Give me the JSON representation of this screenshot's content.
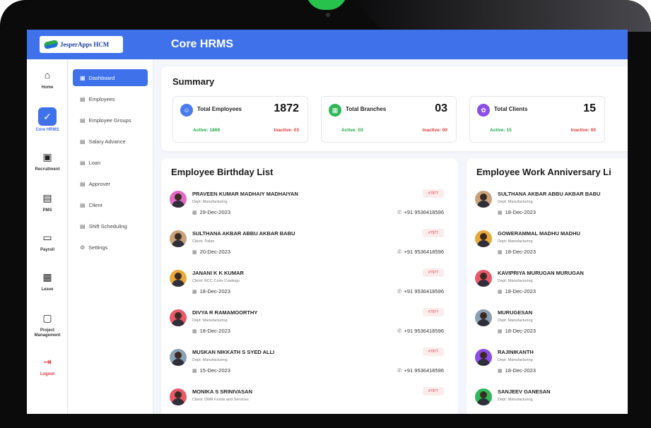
{
  "header": {
    "logo_text": "JesperApps HCM",
    "title": "Core HRMS"
  },
  "rail": [
    {
      "label": "Home",
      "icon": "home-icon",
      "glyph": "⌂"
    },
    {
      "label": "Core HRMS",
      "icon": "shield-check-icon",
      "glyph": "✓",
      "active": true
    },
    {
      "label": "Recruitment",
      "icon": "briefcase-icon",
      "glyph": "▣"
    },
    {
      "label": "PMS",
      "icon": "clipboard-icon",
      "glyph": "▤"
    },
    {
      "label": "Payroll",
      "icon": "wallet-icon",
      "glyph": "▭"
    },
    {
      "label": "Leave",
      "icon": "calendar-icon",
      "glyph": "▦"
    },
    {
      "label": "Project Management",
      "icon": "document-icon",
      "glyph": "▢"
    },
    {
      "label": "Logout",
      "icon": "logout-icon",
      "glyph": "⇥"
    }
  ],
  "submenu": [
    {
      "label": "Dashboard",
      "icon": "grid-icon",
      "active": true
    },
    {
      "label": "Employees",
      "icon": "list-icon"
    },
    {
      "label": "Employee Groups",
      "icon": "list-icon"
    },
    {
      "label": "Salary Advance",
      "icon": "list-icon"
    },
    {
      "label": "Loan",
      "icon": "list-icon"
    },
    {
      "label": "Approver",
      "icon": "list-icon"
    },
    {
      "label": "Client",
      "icon": "list-icon"
    },
    {
      "label": "Shift Scheduling",
      "icon": "list-icon"
    },
    {
      "label": "Settings",
      "icon": "gear-icon"
    }
  ],
  "summary": {
    "title": "Summary",
    "stats": [
      {
        "label": "Total Employees",
        "value": "1872",
        "active": "Active: 1869",
        "inactive": "Inactive: 03",
        "icon": "users-icon",
        "color": "#4a7bee"
      },
      {
        "label": "Total Branches",
        "value": "03",
        "active": "Active: 03",
        "inactive": "Inactive: 00",
        "icon": "building-icon",
        "color": "#2fb75a"
      },
      {
        "label": "Total Clients",
        "value": "15",
        "active": "Active: 15",
        "inactive": "Inactive: 00",
        "icon": "handshake-icon",
        "color": "#8b4ee6"
      }
    ]
  },
  "birthdays": {
    "title": "Employee Birthday List",
    "items": [
      {
        "name": "PRAVEEN KUMAR MADHAIY MADHAIYAN",
        "sub": "Dept: Manufacturing",
        "date": "29-Dec-2023",
        "badge": "#7977",
        "phone": "+91 9536418596",
        "ring": "#e26ac5"
      },
      {
        "name": "SULTHANA AKBAR ABBU AKBAR BABU",
        "sub": "Client: Tollan",
        "date": "20-Dec-2023",
        "badge": "#7977",
        "phone": "+91 9536418596",
        "ring": "#c8a27a"
      },
      {
        "name": "JANANI K K KUMAR",
        "sub": "Client: RCC Color Coatings",
        "date": "18-Dec-2023",
        "badge": "#7977",
        "phone": "+91 9536418596",
        "ring": "#e7a93a"
      },
      {
        "name": "DIVYA R RAMAMOORTHY",
        "sub": "Dept: Manufacturing",
        "date": "18-Dec-2023",
        "badge": "#7977",
        "phone": "+91 9536418596",
        "ring": "#e85a6a"
      },
      {
        "name": "MUSKAN NIKKATH S SYED ALLI",
        "sub": "Dept: Manufacturing",
        "date": "15-Dec-2023",
        "badge": "#7977",
        "phone": "+91 9536418596",
        "ring": "#8aa0b3"
      },
      {
        "name": "MONIKA S SRINIVASAN",
        "sub": "Client: DMR Foods and Services",
        "date": "",
        "badge": "#7977",
        "phone": "",
        "ring": "#e85a6a"
      }
    ]
  },
  "anniversaries": {
    "title": "Employee Work Anniversary Li",
    "items": [
      {
        "name": "SULTHANA AKBAR ABBU AKBAR BABU",
        "sub": "Dept: Manufacturing",
        "date": "18-Dec-2023",
        "ring": "#c8a27a"
      },
      {
        "name": "GOWERAMMAL MADHU MADHU",
        "sub": "Dept: Manufacturing",
        "date": "18-Dec-2023",
        "ring": "#e7a93a"
      },
      {
        "name": "KAVIPRIYA MURUGAN MURUGAN",
        "sub": "Dept: Manufacturing",
        "date": "18-Dec-2023",
        "ring": "#e85a6a"
      },
      {
        "name": "MURUGESAN",
        "sub": "Dept: Manufacturing",
        "date": "18-Dec-2023",
        "ring": "#8aa0b3"
      },
      {
        "name": "RAJINIKANTH",
        "sub": "Dept: Manufacturing",
        "date": "18-Dec-2023",
        "ring": "#8b4ee6"
      },
      {
        "name": "SANJEEV GANESAN",
        "sub": "Dept: Manufacturing",
        "date": "",
        "ring": "#2fb75a"
      }
    ]
  }
}
